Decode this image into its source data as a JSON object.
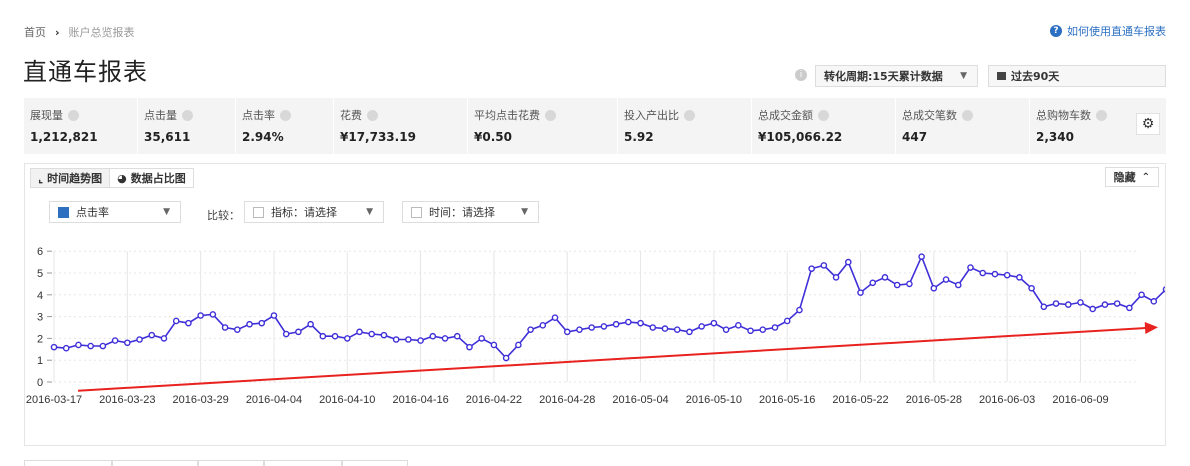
{
  "breadcrumb": {
    "home": "首页",
    "current": "账户总览报表"
  },
  "help": {
    "label": "如何使用直通车报表"
  },
  "page": {
    "title": "直通车报表"
  },
  "controls": {
    "period": "转化周期:15天累计数据",
    "date_range": "过去90天"
  },
  "metrics": [
    {
      "label": "展现量",
      "value": "1,212,821"
    },
    {
      "label": "点击量",
      "value": "35,611"
    },
    {
      "label": "点击率",
      "value": "2.94%"
    },
    {
      "label": "花费",
      "value": "¥17,733.19"
    },
    {
      "label": "平均点击花费",
      "value": "¥0.50"
    },
    {
      "label": "投入产出比",
      "value": "5.92"
    },
    {
      "label": "总成交金额",
      "value": "¥105,066.22"
    },
    {
      "label": "总成交笔数",
      "value": "447"
    },
    {
      "label": "总购物车数",
      "value": "2,340"
    }
  ],
  "chart_panel": {
    "tab_trend": "时间趋势图",
    "tab_share": "数据占比图",
    "hide": "隐藏",
    "metric_select": "点击率",
    "compare_label": "比较：",
    "compare_metric": "指标：请选择",
    "compare_time": "时间：请选择"
  },
  "colors": {
    "line": "#3f2fd8",
    "arrow": "#e8221f",
    "accent": "#2f6fbf"
  },
  "chart_data": {
    "type": "line",
    "ylim": [
      0,
      6
    ],
    "yticks": [
      0,
      1,
      2,
      3,
      4,
      5,
      6
    ],
    "grid": true,
    "x_start": "2016-03-17",
    "xticks": [
      "2016-03-17",
      "2016-03-23",
      "2016-03-29",
      "2016-04-04",
      "2016-04-10",
      "2016-04-16",
      "2016-04-22",
      "2016-04-28",
      "2016-05-04",
      "2016-05-10",
      "2016-05-16",
      "2016-05-22",
      "2016-05-28",
      "2016-06-03",
      "2016-06-09"
    ],
    "values": [
      1.6,
      1.55,
      1.7,
      1.65,
      1.65,
      1.9,
      1.8,
      1.95,
      2.15,
      2.0,
      2.8,
      2.7,
      3.05,
      3.1,
      2.5,
      2.4,
      2.65,
      2.7,
      3.05,
      2.2,
      2.3,
      2.65,
      2.1,
      2.1,
      2.0,
      2.3,
      2.2,
      2.15,
      1.95,
      1.95,
      1.9,
      2.1,
      2.0,
      2.1,
      1.6,
      2.0,
      1.7,
      1.1,
      1.7,
      2.4,
      2.6,
      2.95,
      2.3,
      2.4,
      2.5,
      2.55,
      2.65,
      2.75,
      2.7,
      2.5,
      2.45,
      2.4,
      2.3,
      2.55,
      2.7,
      2.4,
      2.6,
      2.35,
      2.4,
      2.5,
      2.8,
      3.3,
      5.2,
      5.35,
      4.8,
      5.5,
      4.1,
      4.55,
      4.8,
      4.45,
      4.5,
      5.75,
      4.3,
      4.7,
      4.45,
      5.25,
      5.0,
      4.95,
      4.9,
      4.8,
      4.3,
      3.45,
      3.6,
      3.55,
      3.65,
      3.35,
      3.55,
      3.6,
      3.4,
      4.0,
      3.7,
      4.25
    ],
    "trend_arrow": {
      "from": [
        0,
        -0.4
      ],
      "to": [
        91,
        2.5
      ]
    }
  }
}
